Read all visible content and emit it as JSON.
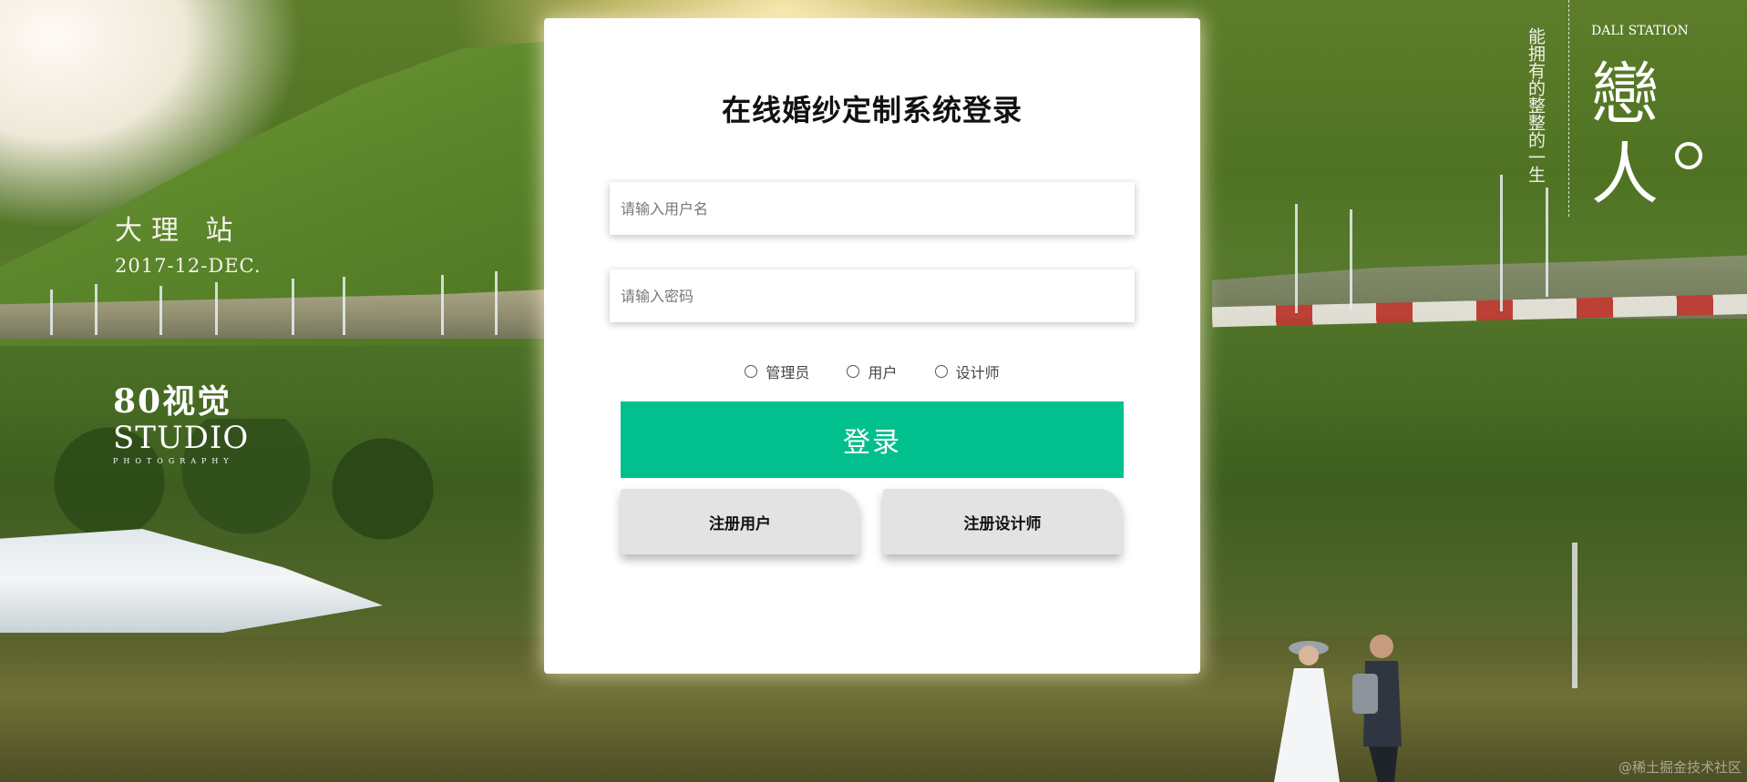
{
  "login": {
    "title": "在线婚纱定制系统登录",
    "username_placeholder": "请输入用户名",
    "password_placeholder": "请输入密码",
    "username_value": "",
    "password_value": "",
    "roles": [
      {
        "label": "管理员",
        "checked": false
      },
      {
        "label": "用户",
        "checked": false
      },
      {
        "label": "设计师",
        "checked": false
      }
    ],
    "login_button": "登录",
    "register_user_button": "注册用户",
    "register_designer_button": "注册设计师"
  },
  "background": {
    "left_title": "大理 站",
    "left_date": "2017-12-DEC.",
    "studio_brand": "80视觉",
    "studio_name": "STUDIO",
    "studio_sub": "PHOTOGRAPHY",
    "vertical_text": "能拥有的整整的一生",
    "station_label": "DALI STATION",
    "big_char_1": "戀",
    "big_char_2": "人",
    "watermark": "@稀土掘金技术社区"
  },
  "colors": {
    "primary": "#02c08d",
    "secondary_button": "#e3e3e3",
    "card_background": "#ffffff",
    "title_text": "#111111"
  }
}
